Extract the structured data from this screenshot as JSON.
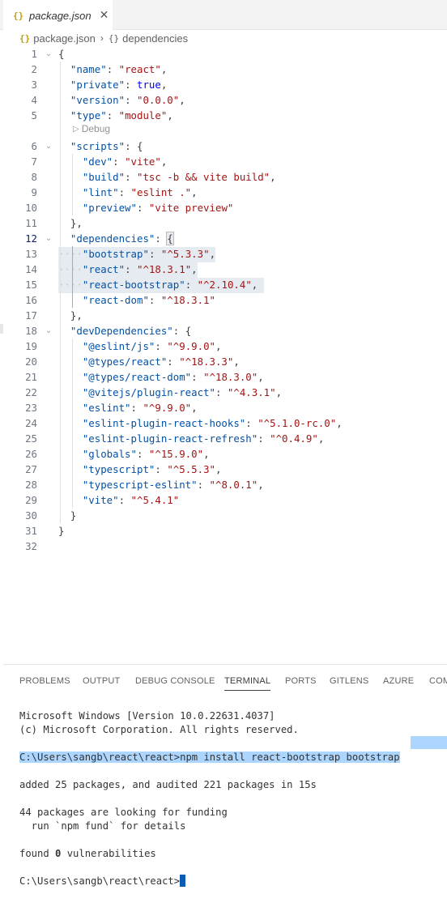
{
  "tab": {
    "icon": "{}",
    "label": "package.json",
    "close": "✕"
  },
  "breadcrumb": {
    "file": "package.json",
    "separator": "›",
    "node": "dependencies",
    "icon": "{}"
  },
  "codelens": {
    "label": "Debug"
  },
  "lines": [
    {
      "n": "1",
      "text": "{"
    },
    {
      "n": "2",
      "text": "\"name\": \"react\","
    },
    {
      "n": "3",
      "text": "\"private\": true,"
    },
    {
      "n": "4",
      "text": "\"version\": \"0.0.0\","
    },
    {
      "n": "5",
      "text": "\"type\": \"module\","
    },
    {
      "n": "6",
      "text": "\"scripts\": {"
    },
    {
      "n": "7",
      "text": "\"dev\": \"vite\","
    },
    {
      "n": "8",
      "text": "\"build\": \"tsc -b && vite build\","
    },
    {
      "n": "9",
      "text": "\"lint\": \"eslint .\","
    },
    {
      "n": "10",
      "text": "\"preview\": \"vite preview\""
    },
    {
      "n": "11",
      "text": "},"
    },
    {
      "n": "12",
      "text": "\"dependencies\": {"
    },
    {
      "n": "13",
      "text": "\"bootstrap\": \"^5.3.3\","
    },
    {
      "n": "14",
      "text": "\"react\": \"^18.3.1\","
    },
    {
      "n": "15",
      "text": "\"react-bootstrap\": \"^2.10.4\","
    },
    {
      "n": "16",
      "text": "\"react-dom\": \"^18.3.1\""
    },
    {
      "n": "17",
      "text": "},"
    },
    {
      "n": "18",
      "text": "\"devDependencies\": {"
    },
    {
      "n": "19",
      "text": "\"@eslint/js\": \"^9.9.0\","
    },
    {
      "n": "20",
      "text": "\"@types/react\": \"^18.3.3\","
    },
    {
      "n": "21",
      "text": "\"@types/react-dom\": \"^18.3.0\","
    },
    {
      "n": "22",
      "text": "\"@vitejs/plugin-react\": \"^4.3.1\","
    },
    {
      "n": "23",
      "text": "\"eslint\": \"^9.9.0\","
    },
    {
      "n": "24",
      "text": "\"eslint-plugin-react-hooks\": \"^5.1.0-rc.0\","
    },
    {
      "n": "25",
      "text": "\"eslint-plugin-react-refresh\": \"^0.4.9\","
    },
    {
      "n": "26",
      "text": "\"globals\": \"^15.9.0\","
    },
    {
      "n": "27",
      "text": "\"typescript\": \"^5.5.3\","
    },
    {
      "n": "28",
      "text": "\"typescript-eslint\": \"^8.0.1\","
    },
    {
      "n": "29",
      "text": "\"vite\": \"^5.4.1\""
    },
    {
      "n": "30",
      "text": "}"
    },
    {
      "n": "31",
      "text": "}"
    },
    {
      "n": "32",
      "text": ""
    }
  ],
  "panel": {
    "tabs": [
      "PROBLEMS",
      "OUTPUT",
      "DEBUG CONSOLE",
      "TERMINAL",
      "PORTS",
      "GITLENS",
      "AZURE",
      "COM"
    ],
    "active_tab": "TERMINAL"
  },
  "terminal": {
    "line1": "Microsoft Windows [Version 10.0.22631.4037]",
    "line2": "(c) Microsoft Corporation. All rights reserved.",
    "command": "C:\\Users\\sangb\\react\\react>npm install react-bootstrap bootstrap",
    "added": "added 25 packages, and audited 221 packages in 15s",
    "funding1": "44 packages are looking for funding",
    "funding2": "  run `npm fund` for details",
    "found_prefix": "found ",
    "found_count": "0",
    "found_suffix": " vulnerabilities",
    "prompt": "C:\\Users\\sangb\\react\\react>"
  },
  "colors": {
    "key": "#0451a5",
    "string": "#a31515",
    "keyword": "#0000ff",
    "selection": "#add6ff"
  }
}
